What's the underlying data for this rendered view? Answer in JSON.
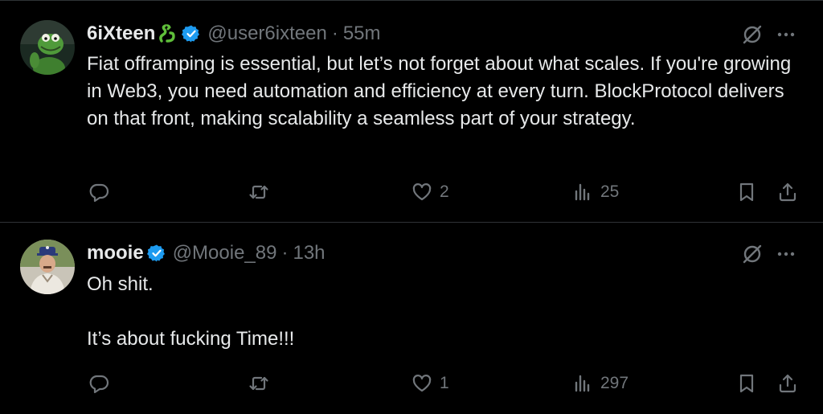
{
  "tweets": [
    {
      "name": "6iXteen",
      "name_emoji_icon": "snake-emoji-icon",
      "handle": "@user6ixteen",
      "separator": "·",
      "time": "55m",
      "body": [
        "Fiat offramping is essential, but let’s not forget about what scales. If you're growing in Web3, you need automation and efficiency at every turn. BlockProtocol delivers on that front, making scalability a seamless part of your strategy."
      ],
      "replies": "",
      "retweets": "",
      "likes": "2",
      "views": "25"
    },
    {
      "name": "mooie",
      "handle": "@Mooie_89",
      "separator": "·",
      "time": "13h",
      "body": [
        "Oh shit.",
        "It’s about fucking Time!!!"
      ],
      "replies": "",
      "retweets": "",
      "likes": "1",
      "views": "297"
    }
  ],
  "colors": {
    "background": "#000000",
    "text": "#e7e9ea",
    "secondary": "#71767b",
    "verified": "#1d9bf0",
    "divider": "#2f3336"
  },
  "icons": [
    "reply-icon",
    "retweet-icon",
    "like-icon",
    "views-icon",
    "bookmark-icon",
    "share-icon",
    "grok-icon",
    "more-icon",
    "verified-badge-icon"
  ]
}
